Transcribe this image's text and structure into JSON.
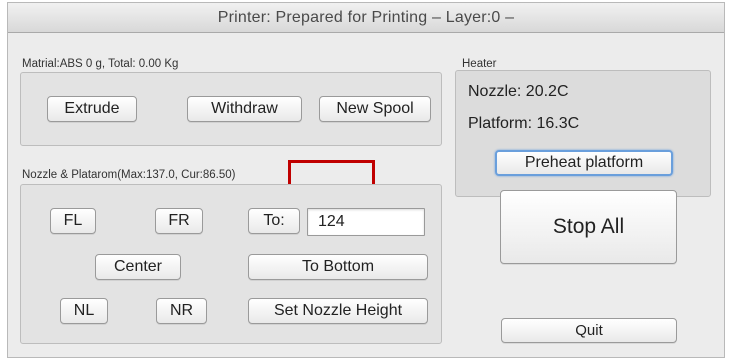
{
  "window": {
    "title": "Printer: Prepared for Printing – Layer:0 –"
  },
  "material": {
    "label": "Matrial:ABS 0 g,  Total: 0.00 Kg",
    "extrude_label": "Extrude",
    "withdraw_label": "Withdraw",
    "new_spool_label": "New Spool"
  },
  "heater": {
    "label": "Heater",
    "nozzle_text": "Nozzle: 20.2C",
    "platform_text": "Platform: 16.3C",
    "preheat_label": "Preheat platform"
  },
  "nozzle": {
    "label": "Nozzle & Platarom(Max:137.0, Cur:86.50)",
    "fl_label": "FL",
    "fr_label": "FR",
    "to_label": "To:",
    "to_value": "124",
    "center_label": "Center",
    "to_bottom_label": "To Bottom",
    "nl_label": "NL",
    "nr_label": "NR",
    "set_height_label": "Set Nozzle  Height"
  },
  "actions": {
    "stop_all_label": "Stop All",
    "quit_label": "Quit"
  },
  "colors": {
    "highlight": "#c00000",
    "focus": "#6a9fdc"
  }
}
